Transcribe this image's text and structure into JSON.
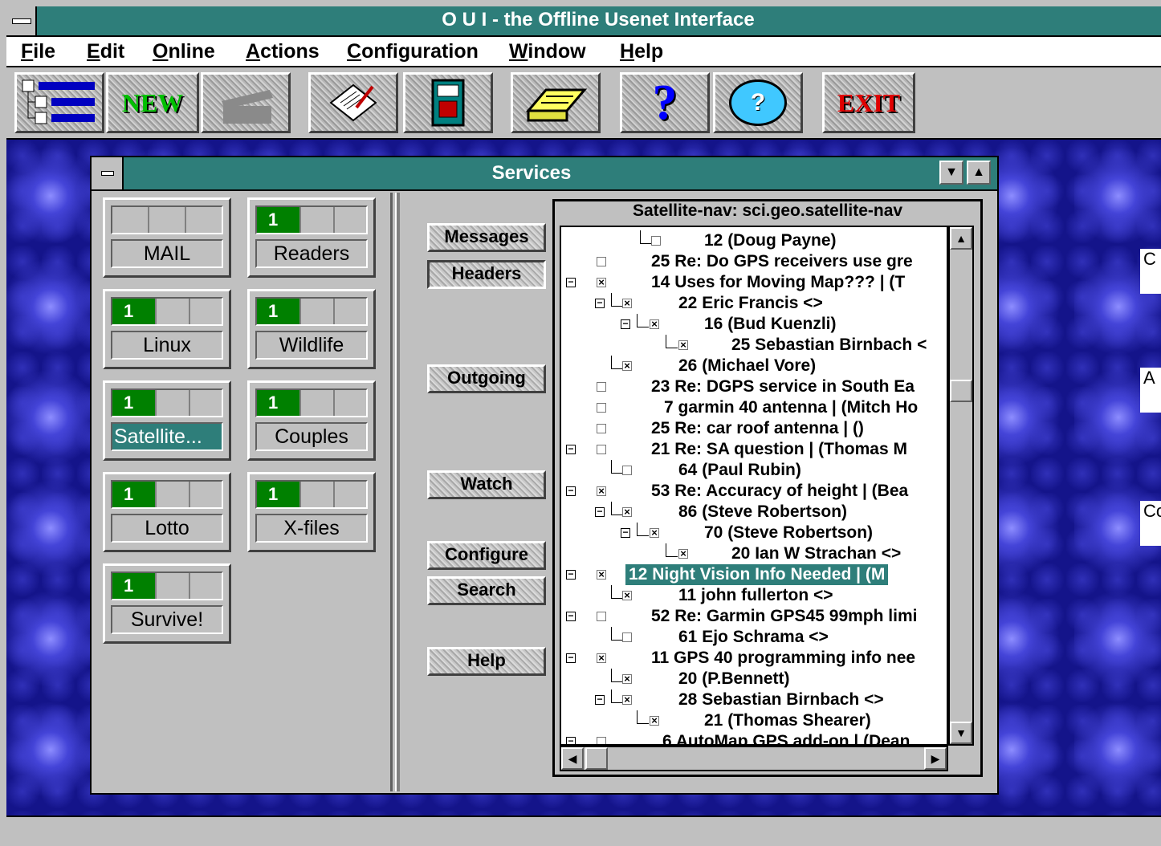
{
  "app": {
    "title": "O U I - the Offline Usenet Interface"
  },
  "menu": [
    {
      "label": "File",
      "key": "F",
      "rest": "ile"
    },
    {
      "label": "Edit",
      "key": "E",
      "rest": "dit"
    },
    {
      "label": "Online",
      "key": "O",
      "rest": "nline"
    },
    {
      "label": "Actions",
      "key": "A",
      "rest": "ctions"
    },
    {
      "label": "Configuration",
      "key": "C",
      "rest": "onfiguration"
    },
    {
      "label": "Window",
      "key": "W",
      "rest": "indow"
    },
    {
      "label": "Help",
      "key": "H",
      "rest": "elp"
    }
  ],
  "toolbar": {
    "new_label": "NEW",
    "exit_label": "EXIT",
    "help_glyph": "?",
    "about_glyph": "?"
  },
  "side_boxes": [
    "C",
    "A",
    "Co"
  ],
  "services": {
    "title": "Services",
    "tiles": [
      {
        "name": "MAIL",
        "count": ""
      },
      {
        "name": "Readers",
        "count": "1"
      },
      {
        "name": "Linux",
        "count": "1"
      },
      {
        "name": "Wildlife",
        "count": "1"
      },
      {
        "name": "Satellite...",
        "count": "1"
      },
      {
        "name": "Couples",
        "count": "1"
      },
      {
        "name": "Lotto",
        "count": "1"
      },
      {
        "name": "X-files",
        "count": "1"
      },
      {
        "name": "Survive!",
        "count": "1"
      }
    ],
    "buttons": {
      "messages": "Messages",
      "headers": "Headers",
      "outgoing": "Outgoing",
      "watch": "Watch",
      "configure": "Configure",
      "search": "Search",
      "help": "Help"
    },
    "tree_title": "Satellite-nav: sci.geo.satellite-nav",
    "threads": [
      "12 (Doug Payne)",
      "25 Re: Do GPS receivers use gre",
      "14 Uses for Moving Map??? | (T",
      "22 Eric Francis <>",
      "16 (Bud Kuenzli)",
      "25 Sebastian Birnbach <",
      "26 (Michael Vore)",
      "23 Re: DGPS service in South Ea",
      "7 garmin 40 antenna | (Mitch Ho",
      "25 Re: car roof antenna | ()",
      "21 Re: SA question | (Thomas M",
      "64 (Paul Rubin)",
      "53 Re: Accuracy of height | (Bea",
      "86 (Steve Robertson)",
      "70 (Steve Robertson)",
      "20 Ian W Strachan <>",
      "12 Night Vision Info Needed | (M",
      "11 john fullerton <>",
      "52 Re: Garmin GPS45 99mph limi",
      "61 Ejo Schrama <>",
      "11 GPS 40 programming info nee",
      "20 (P.Bennett)",
      "28 Sebastian Birnbach <>",
      "21 (Thomas Shearer)",
      "6 AutoMap GPS add-on | (Dean"
    ]
  }
}
